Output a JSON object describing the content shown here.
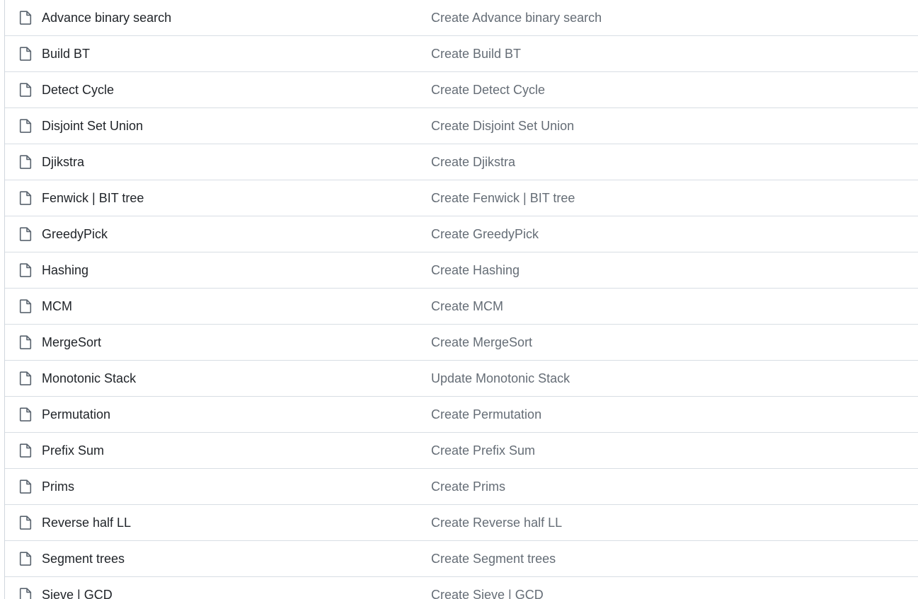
{
  "files": [
    {
      "name": "Advance binary search",
      "message": "Create Advance binary search",
      "icon": "file-icon"
    },
    {
      "name": "Build BT",
      "message": "Create Build BT",
      "icon": "file-icon"
    },
    {
      "name": "Detect Cycle",
      "message": "Create Detect Cycle",
      "icon": "file-icon"
    },
    {
      "name": "Disjoint Set Union",
      "message": "Create Disjoint Set Union",
      "icon": "file-icon"
    },
    {
      "name": "Djikstra",
      "message": "Create Djikstra",
      "icon": "file-icon"
    },
    {
      "name": "Fenwick | BIT tree",
      "message": "Create Fenwick | BIT tree",
      "icon": "file-icon"
    },
    {
      "name": "GreedyPick",
      "message": "Create GreedyPick",
      "icon": "file-icon"
    },
    {
      "name": "Hashing",
      "message": "Create Hashing",
      "icon": "file-icon"
    },
    {
      "name": "MCM",
      "message": "Create MCM",
      "icon": "file-icon"
    },
    {
      "name": "MergeSort",
      "message": "Create MergeSort",
      "icon": "file-icon"
    },
    {
      "name": "Monotonic Stack",
      "message": "Update Monotonic Stack",
      "icon": "file-icon"
    },
    {
      "name": "Permutation",
      "message": "Create Permutation",
      "icon": "file-icon"
    },
    {
      "name": "Prefix Sum",
      "message": "Create Prefix Sum",
      "icon": "file-icon"
    },
    {
      "name": "Prims",
      "message": "Create Prims",
      "icon": "file-icon"
    },
    {
      "name": "Reverse half LL",
      "message": "Create Reverse half LL",
      "icon": "file-icon"
    },
    {
      "name": "Segment trees",
      "message": "Create Segment trees",
      "icon": "file-icon"
    },
    {
      "name": "Sieve | GCD",
      "message": "Create Sieve | GCD",
      "icon": "file-icon"
    }
  ],
  "colors": {
    "file_name": "#1f2328",
    "commit_message": "#656d76",
    "row_border": "#d8dee4",
    "icon_stroke": "#59636e"
  }
}
